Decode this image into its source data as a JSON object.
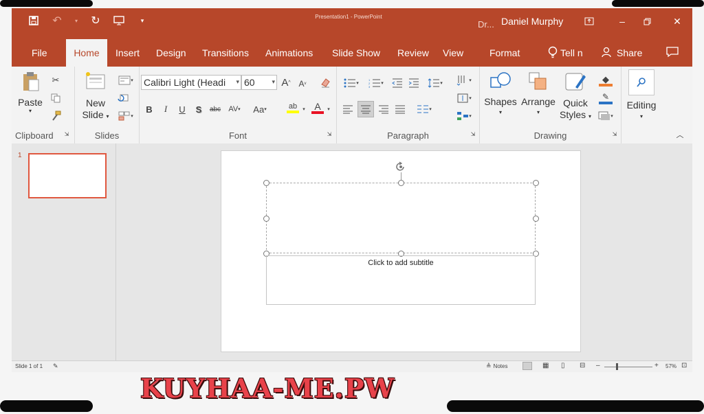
{
  "titlebar": {
    "document_title": "Presentation1 - PowerPoint",
    "user_name": "Daniel Murphy",
    "user_initials_hint": "Dr...",
    "colors": {
      "accent": "#b7472a",
      "accent_light": "#e0573e"
    }
  },
  "tabs": [
    {
      "label": "File"
    },
    {
      "label": "Home",
      "active": true
    },
    {
      "label": "Insert"
    },
    {
      "label": "Design"
    },
    {
      "label": "Transitions"
    },
    {
      "label": "Animations"
    },
    {
      "label": "Slide Show"
    },
    {
      "label": "Review"
    },
    {
      "label": "View"
    },
    {
      "label": "Format"
    }
  ],
  "tell_me": "Tell n",
  "share": "Share",
  "ribbon": {
    "clipboard": {
      "label": "Clipboard",
      "paste": "Paste"
    },
    "slides": {
      "label": "Slides",
      "new_slide_1": "New",
      "new_slide_2": "Slide"
    },
    "font": {
      "label": "Font",
      "font_name": "Calibri Light (Headi",
      "font_size": "60"
    },
    "paragraph": {
      "label": "Paragraph"
    },
    "drawing": {
      "label": "Drawing",
      "shapes": "Shapes",
      "arrange": "Arrange",
      "quick_1": "Quick",
      "quick_2": "Styles"
    },
    "editing": {
      "label": "Editing"
    }
  },
  "slides_pane": {
    "slide_number": "1"
  },
  "slide": {
    "subtitle_placeholder": "Click to add subtitle"
  },
  "statusbar": {
    "slide_info": "Slide 1 of 1",
    "notes": "Notes",
    "zoom": "57%"
  },
  "watermark": "KUYHAA-ME.PW"
}
